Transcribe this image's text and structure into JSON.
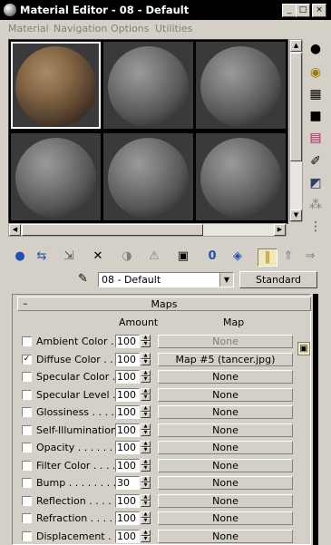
{
  "window": {
    "title": "Material Editor - 08 - Default",
    "minimize": "_",
    "maximize": "□",
    "close": "×"
  },
  "menu": [
    "Material",
    "Navigation",
    "Options",
    "Utilities"
  ],
  "slots": [
    {
      "type": "textured",
      "active": true
    },
    {
      "type": "gray"
    },
    {
      "type": "gray"
    },
    {
      "type": "gray"
    },
    {
      "type": "gray"
    },
    {
      "type": "gray"
    }
  ],
  "side_tools": [
    "sample-type-icon",
    "backlight-icon",
    "background-icon",
    "uv-tiling-icon",
    "video-color-check-icon",
    "make-preview-icon",
    "options-icon",
    "select-by-material-icon",
    "material-navigator-icon"
  ],
  "toolbar": {
    "icons": [
      "get-material-icon",
      "put-to-scene-icon",
      "assign-to-selection-icon",
      "reset-map-icon",
      "make-copy-icon",
      "make-unique-icon",
      "put-to-library-icon",
      "material-id-icon",
      "show-map-in-viewport-icon",
      "show-end-result-icon",
      "go-to-parent-icon",
      "go-forward-icon"
    ],
    "glyphs": [
      "●",
      "⇆",
      "⇲",
      "✕",
      "◑",
      "⚠",
      "▣",
      "0",
      "◈",
      "‖",
      "⇑",
      "⇒"
    ]
  },
  "material": {
    "eyedropper": "✎",
    "name": "08 - Default",
    "type_button": "Standard"
  },
  "maps_rollout": {
    "toggle": "–",
    "title": "Maps",
    "col_amount": "Amount",
    "col_map": "Map",
    "lock": "🔒",
    "rows": [
      {
        "label": "Ambient Color . .",
        "checked": false,
        "amount": "100",
        "map": "None",
        "dim": true
      },
      {
        "label": "Diffuse Color . . . .",
        "checked": true,
        "amount": "100",
        "map": "Map #5 (tancer.jpg)",
        "dim": false
      },
      {
        "label": "Specular Color  . .",
        "checked": false,
        "amount": "100",
        "map": "None",
        "dim": false
      },
      {
        "label": "Specular Level  .",
        "checked": false,
        "amount": "100",
        "map": "None",
        "dim": false
      },
      {
        "label": "Glossiness  . . . . .",
        "checked": false,
        "amount": "100",
        "map": "None",
        "dim": false
      },
      {
        "label": "Self-Illumination .",
        "checked": false,
        "amount": "100",
        "map": "None",
        "dim": false
      },
      {
        "label": "Opacity  . . . . . . .",
        "checked": false,
        "amount": "100",
        "map": "None",
        "dim": false
      },
      {
        "label": "Filter Color  . . . .",
        "checked": false,
        "amount": "100",
        "map": "None",
        "dim": false
      },
      {
        "label": "Bump  . . . . . . . .",
        "checked": false,
        "amount": "30",
        "map": "None",
        "dim": false
      },
      {
        "label": "Reflection  . . . . .",
        "checked": false,
        "amount": "100",
        "map": "None",
        "dim": false
      },
      {
        "label": "Refraction  . . . . .",
        "checked": false,
        "amount": "100",
        "map": "None",
        "dim": false
      },
      {
        "label": "Displacement  . .",
        "checked": false,
        "amount": "100",
        "map": "None",
        "dim": false
      }
    ]
  }
}
